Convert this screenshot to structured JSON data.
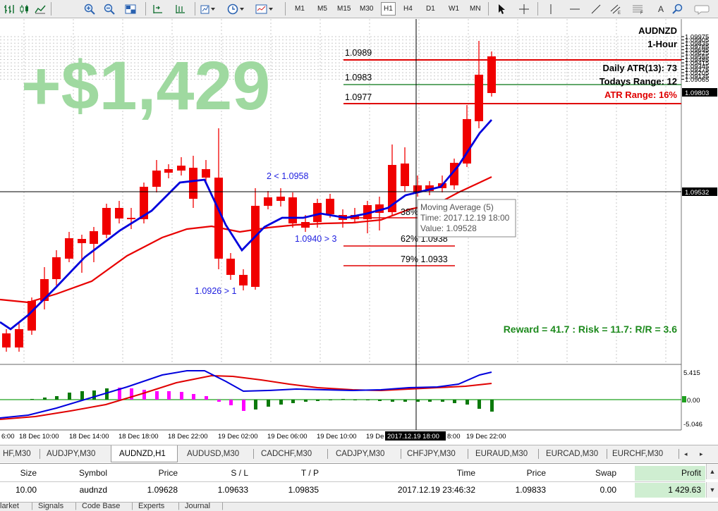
{
  "toolbar": {
    "timeframes": [
      "M1",
      "M5",
      "M15",
      "M30",
      "H1",
      "H4",
      "D1",
      "W1",
      "MN"
    ],
    "active_timeframe": "H1",
    "text_tool": "A"
  },
  "chart": {
    "symbol": "AUDNZD",
    "timeframe": "1-Hour",
    "profit_overlay": "+$1,429",
    "daily_atr": "Daily ATR(13): 73",
    "todays_range": "Todays Range: 12",
    "atr_range": "ATR Range: 16%",
    "reward_risk": "Reward = 41.7 : Risk = 11.7: R/R = 3.6",
    "level_labels": [
      "1.0989",
      "1.0983",
      "1.0977"
    ],
    "fib_labels": [
      "38%",
      "62% 1.0938",
      "79% 1.0933"
    ],
    "swing_labels": [
      "2 < 1.0958",
      "1.0940 > 3",
      "1.0926 > 1"
    ],
    "tooltip": {
      "title": "Moving Average (5)",
      "time": "Time: 2017.12.19 18:00",
      "value": "Value: 1.09528"
    },
    "price_axis": [
      "1.09975",
      "1.09905",
      "1.09835",
      "1.09765",
      "1.09695",
      "1.09625",
      "1.09555",
      "1.09485",
      "1.09415",
      "1.09345",
      "1.09275",
      "1.09205",
      "1.09135",
      "1.09065"
    ],
    "current_price": "1.09803",
    "crosshair_price": "1.09532",
    "indicator_axis": [
      "5.415",
      "0.00",
      "-5.046"
    ],
    "time_axis": [
      "18 Dec 10:00",
      "18 Dec 14:00",
      "18 Dec 18:00",
      "18 Dec 22:00",
      "19 Dec 02:00",
      "19 Dec 06:00",
      "19 Dec 10:00",
      "19 Dec 22:00"
    ],
    "time_axis_edge_left": "6:00",
    "time_axis_partial": "19 De",
    "time_axis_after_cursor": "8:00",
    "crosshair_time": "2017.12.19 18:00",
    "colors": {
      "bull": "#1fc51f",
      "bear": "#f00000",
      "ma_fast": "#0000dd",
      "ma_slow": "#e80000",
      "level_red": "#e00000",
      "level_green": "#2e8b3a",
      "profit_text": "#9fd9a0",
      "reward_text": "#1d8a1d",
      "swing_text": "#2020e0",
      "hist_pos": "#0b7a0b",
      "hist_neg": "#ff00ff"
    }
  },
  "chart_tabs": [
    "HF,M30",
    "AUDJPY,M30",
    "AUDNZD,H1",
    "AUDUSD,M30",
    "CADCHF,M30",
    "CADJPY,M30",
    "CHFJPY,M30",
    "EURAUD,M30",
    "EURCAD,M30",
    "EURCHF,M30"
  ],
  "active_chart_tab": "AUDNZD,H1",
  "trade": {
    "headers": [
      "Size",
      "Symbol",
      "Price",
      "S / L",
      "T / P",
      "Time",
      "Price",
      "Swap",
      "Profit"
    ],
    "row": [
      "10.00",
      "audnzd",
      "1.09628",
      "1.09633",
      "1.09835",
      "2017.12.19 23:46:32",
      "1.09833",
      "0.00",
      "1 429.63"
    ]
  },
  "terminal_tabs": [
    "larket",
    "Signals",
    "Code Base",
    "Experts",
    "Journal"
  ]
}
